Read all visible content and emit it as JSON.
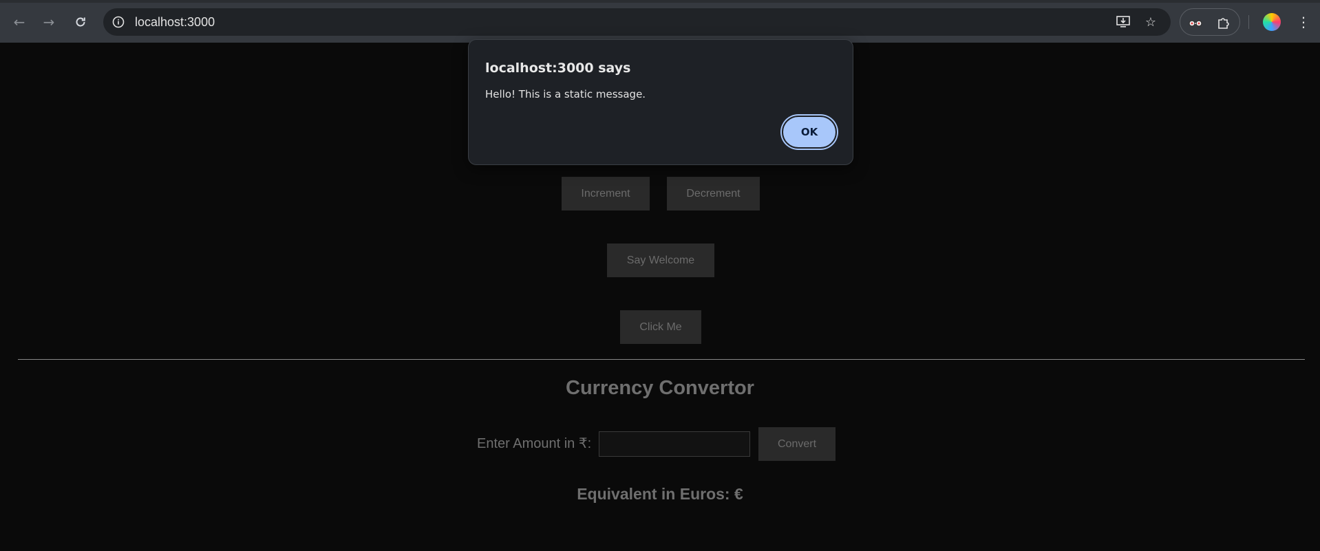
{
  "browser": {
    "url": "localhost:3000",
    "icons": {
      "back": "arrow-left-icon",
      "forward": "arrow-right-icon",
      "reload": "reload-icon",
      "site_info": "info-icon",
      "install": "install-app-icon",
      "bookmark": "star-icon",
      "extension": "glasses-icon",
      "extensions_menu": "puzzle-icon",
      "profile": "profile-avatar",
      "menu": "kebab-menu-icon"
    }
  },
  "page": {
    "buttons": {
      "increment": "Increment",
      "decrement": "Decrement",
      "welcome": "Say Welcome",
      "click_me": "Click Me"
    },
    "currency": {
      "title": "Currency Convertor",
      "label": "Enter Amount in ₹:",
      "input_value": "",
      "convert": "Convert",
      "result": "Equivalent in Euros: €"
    },
    "colors": {
      "background": "#0a0a0a",
      "button_bg": "#2a2a2a",
      "text_muted": "#6f6f6f"
    }
  },
  "dialog": {
    "title": "localhost:3000 says",
    "message": "Hello! This is a static message.",
    "ok_label": "OK",
    "accent": "#a8c7fa"
  }
}
